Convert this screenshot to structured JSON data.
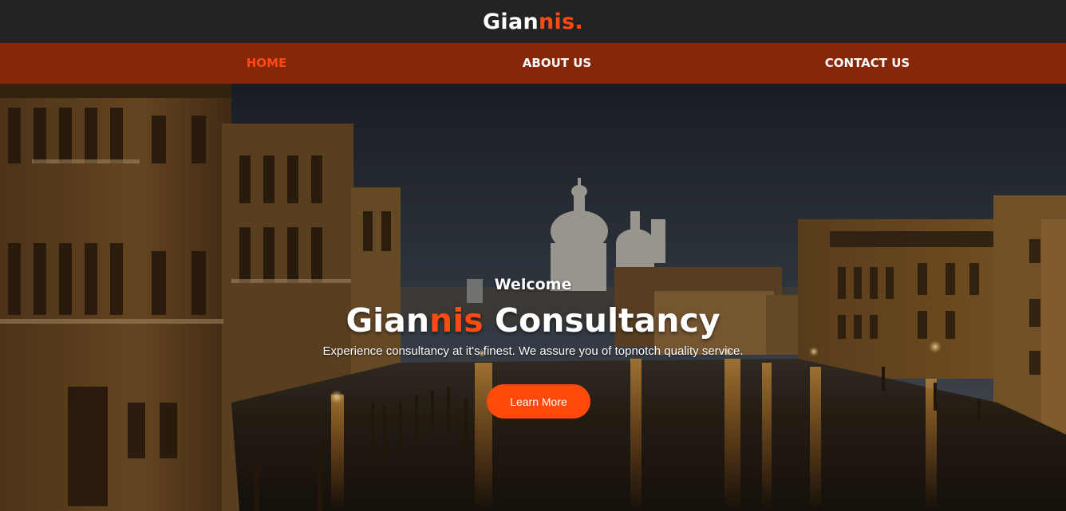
{
  "brand": {
    "logo_prefix": "Gian",
    "logo_accent": "nis.",
    "accent_color": "#ff4a14"
  },
  "nav": {
    "items": [
      {
        "label": "HOME",
        "active": true
      },
      {
        "label": "ABOUT US",
        "active": false
      },
      {
        "label": "CONTACT US",
        "active": false
      }
    ],
    "bar_color": "#852708"
  },
  "hero": {
    "welcome": "Welcome",
    "title_prefix": "Gian",
    "title_accent": "nis",
    "title_suffix": " Consultancy",
    "subtitle": "Experience consultancy at it's finest. We assure you of topnotch quality service.",
    "button_label": "Learn More",
    "button_color": "#ff4a0c"
  }
}
